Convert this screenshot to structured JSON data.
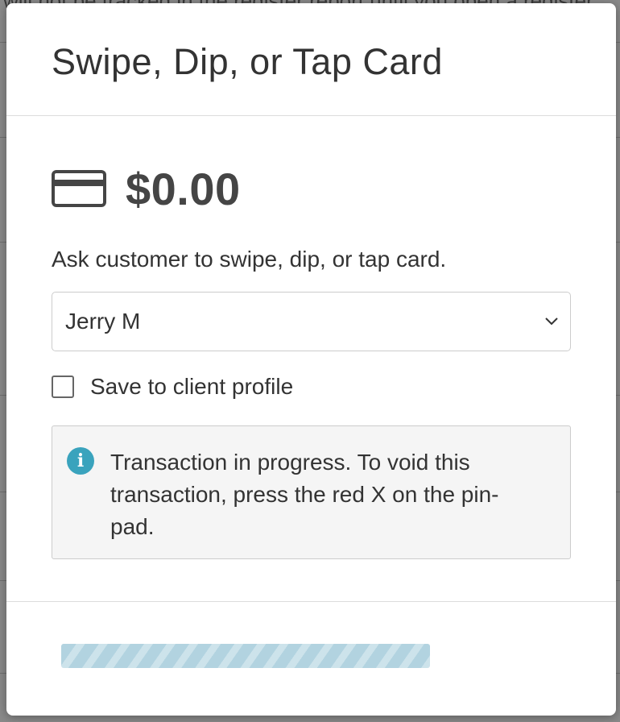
{
  "backdrop": {
    "text": "will not be tracked in the register report until you open a register"
  },
  "modal": {
    "title": "Swipe, Dip, or Tap Card",
    "amount": "$0.00",
    "card_icon": "credit-card-icon",
    "instructions": "Ask customer to swipe, dip, or tap card.",
    "client_select": {
      "value": "Jerry M"
    },
    "save_profile": {
      "label": "Save to client profile",
      "checked": false
    },
    "info": {
      "icon": "info-icon",
      "message": "Transaction in progress. To void this transaction, press the red X on the pin-pad."
    },
    "progress": {
      "state": "indeterminate"
    }
  },
  "colors": {
    "info_icon": "#3aa3bd",
    "progress": "#aacfdd",
    "text": "#333333"
  }
}
